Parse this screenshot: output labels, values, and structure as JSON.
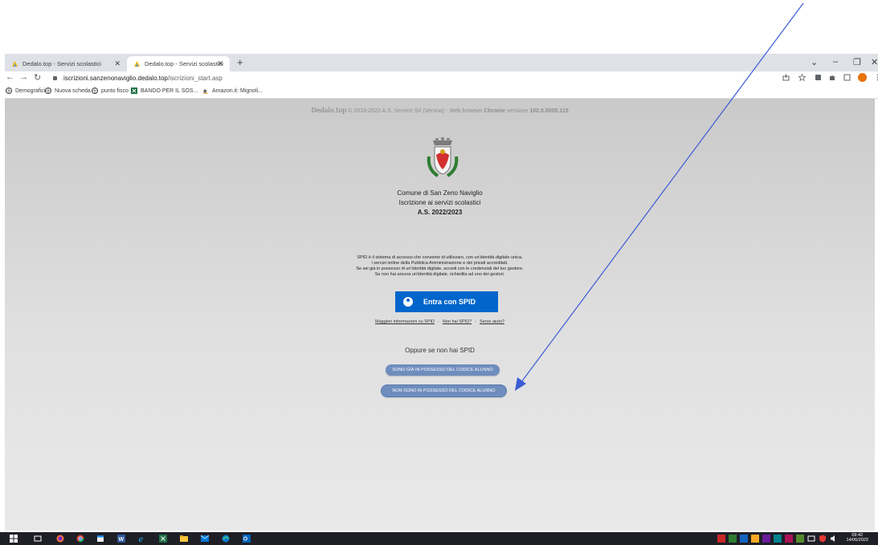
{
  "browser": {
    "tabs": [
      {
        "label": "Dedalo.top - Servizi scolastici",
        "active": false
      },
      {
        "label": "Dedalo.top - Servizi scolastici",
        "active": true
      }
    ],
    "url_host": "iscrizioni.sanzenonaviglio.dedalo.top",
    "url_path": "/iscrizioni_start.asp",
    "bookmarks": [
      "Demografici",
      "Nuova scheda",
      "punto fisco",
      "BANDO PER IL SOS...",
      "Amazon.it: Mignoli..."
    ],
    "profile_initial": "S",
    "accent": "#e8710a"
  },
  "page": {
    "footer_brand": "Dedalo.top",
    "footer_copy": "© 2016-2022 A.S. Service Srl (Verona) - Web browser ",
    "footer_browser": "Chrome",
    "footer_version_text": " versione ",
    "footer_version": "102.0.5005.115",
    "comune": "Comune di San Zeno Naviglio",
    "service": "Iscrizione ai servizi scolastici",
    "anno": "A.S. 2022/2023",
    "spid_desc": [
      "SPID è il sistema di accesso che consente di utilizzare, con un'identità digitale unica,",
      "i servizi online della Pubblica Amministrazione e dei privati accreditati.",
      "Se sei già in possesso di un'identità digitale, accedi con le credenziali del tuo gestore.",
      "Se non hai ancora un'identità digitale, richiedila ad uno dei gestori."
    ],
    "spid_button": "Entra con SPID",
    "links": [
      "Maggiori informazioni su SPID",
      "Non hai SPID?",
      "Serve aiuto?"
    ],
    "link_sep": "-",
    "oppure": "Oppure se non hai SPID",
    "btn_gia": "SONO GIÀ IN POSSESSO DEL CODICE ALUNNO",
    "btn_non": "NON SONO IN POSSESSO DEL CODICE ALUNNO",
    "spid_color": "#0066cc",
    "pill_color": "#6f8dbd",
    "arrow_color": "#3b5bd6"
  },
  "taskbar": {
    "time": "09:42",
    "date": "14/06/2022"
  }
}
